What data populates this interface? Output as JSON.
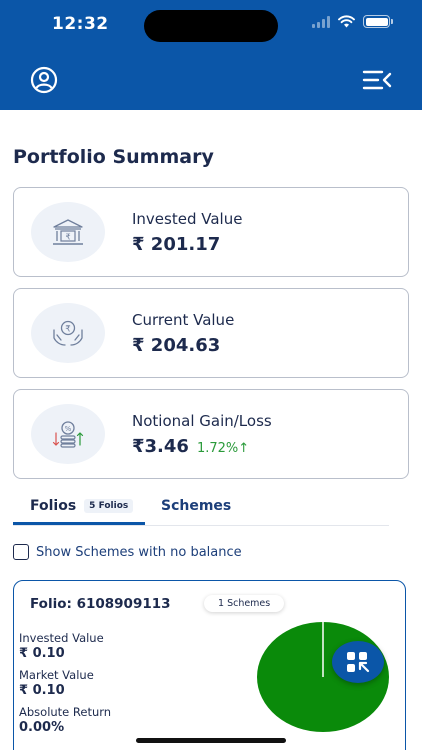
{
  "status_bar": {
    "time": "12:32"
  },
  "header": {
    "profile_icon": "user-circle-icon",
    "menu_icon": "menu-collapse-icon",
    "background": "#0b56a8"
  },
  "page": {
    "title": "Portfolio Summary"
  },
  "cards": [
    {
      "icon": "bank-rupee-icon",
      "label": "Invested Value",
      "value": "₹ 201.17"
    },
    {
      "icon": "hands-rupee-coin-icon",
      "label": "Current Value",
      "value": "₹ 204.63"
    },
    {
      "icon": "coins-percent-icon",
      "label": "Notional Gain/Loss",
      "value": "₹3.46",
      "change": "1.72%↑",
      "change_color": "#2a9a3a"
    }
  ],
  "tabs": {
    "folios": {
      "label": "Folios",
      "badge": "5 Folios",
      "active": true
    },
    "schemes": {
      "label": "Schemes",
      "active": false
    }
  },
  "filter": {
    "label": "Show Schemes with no balance",
    "checked": false
  },
  "folio": {
    "title": "Folio: 6108909113",
    "schemes_badge": "1 Schemes",
    "invested_label": "Invested Value",
    "invested_value": "₹ 0.10",
    "market_label": "Market Value",
    "market_value": "₹ 0.10",
    "return_label": "Absolute Return",
    "return_value": "0.00%",
    "pie_color": "#0a8a0a"
  },
  "fab": {
    "icon": "qr-scan-icon"
  }
}
